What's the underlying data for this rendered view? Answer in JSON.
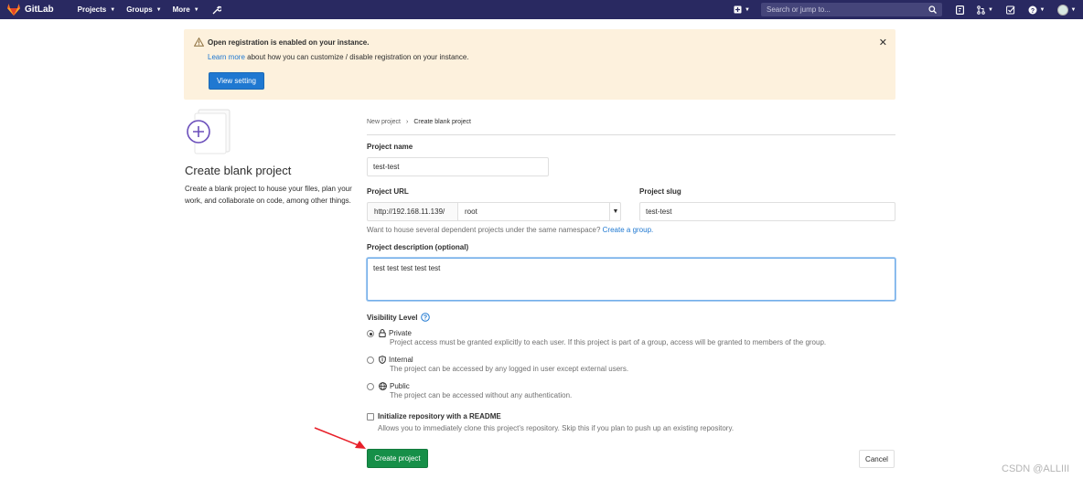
{
  "navbar": {
    "brand": "GitLab",
    "items": [
      {
        "label": "Projects"
      },
      {
        "label": "Groups"
      },
      {
        "label": "More"
      }
    ],
    "search_placeholder": "Search or jump to...",
    "brand_color": "#292961"
  },
  "banner": {
    "title": "Open registration is enabled on your instance.",
    "learn_more": "Learn more",
    "text": "about how you can customize / disable registration on your instance.",
    "button": "View setting"
  },
  "left": {
    "title": "Create blank project",
    "description": "Create a blank project to house your files, plan your work, and collaborate on code, among other things."
  },
  "breadcrumb": {
    "parent": "New project",
    "current": "Create blank project"
  },
  "form": {
    "project_name_label": "Project name",
    "project_name_value": "test-test",
    "project_url_label": "Project URL",
    "url_prefix": "http://192.168.11.139/",
    "namespace": "root",
    "project_slug_label": "Project slug",
    "project_slug_value": "test-test",
    "namespace_help": "Want to house several dependent projects under the same namespace?",
    "create_group_link": "Create a group.",
    "description_label": "Project description (optional)",
    "description_value": "test test test test test",
    "visibility_label": "Visibility Level",
    "visibility": [
      {
        "name": "Private",
        "desc": "Project access must be granted explicitly to each user. If this project is part of a group, access will be granted to members of the group.",
        "checked": true
      },
      {
        "name": "Internal",
        "desc": "The project can be accessed by any logged in user except external users.",
        "checked": false
      },
      {
        "name": "Public",
        "desc": "The project can be accessed without any authentication.",
        "checked": false
      }
    ],
    "readme_label": "Initialize repository with a README",
    "readme_desc": "Allows you to immediately clone this project’s repository. Skip this if you plan to push up an existing repository.",
    "create_button": "Create project",
    "cancel_button": "Cancel"
  },
  "watermark": "CSDN @ALLIII"
}
